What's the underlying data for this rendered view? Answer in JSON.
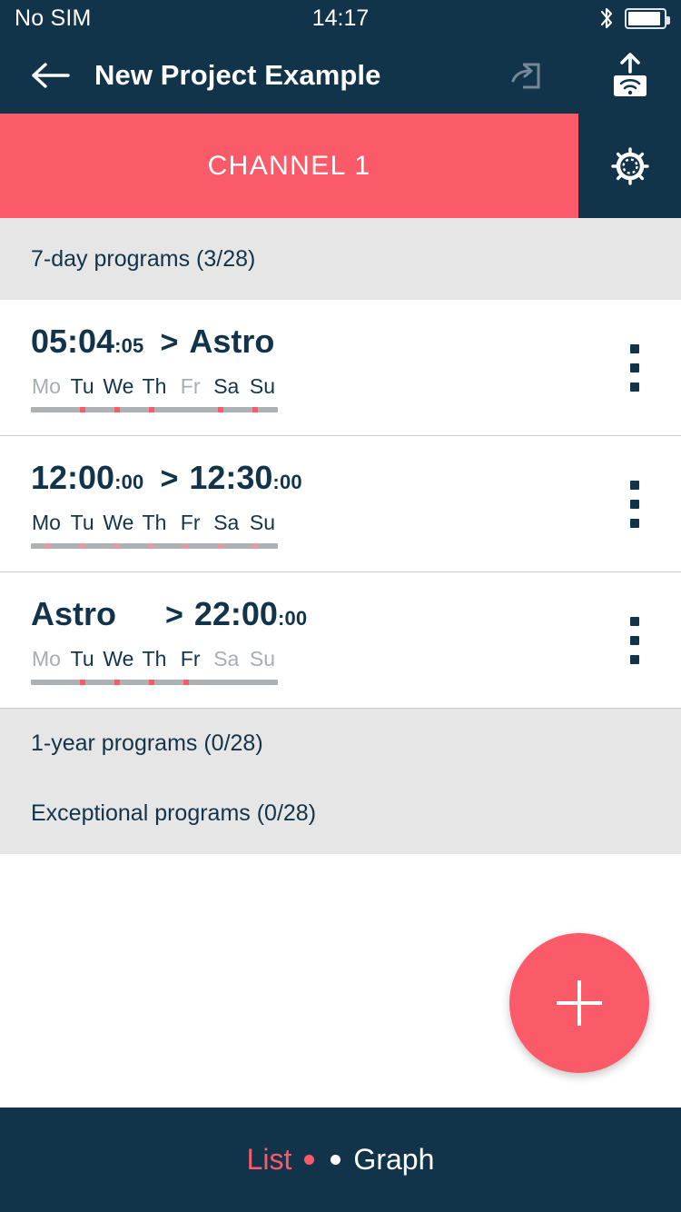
{
  "status_bar": {
    "carrier": "No SIM",
    "time": "14:17",
    "bluetooth_icon": "bluetooth-icon",
    "battery_icon": "battery-icon",
    "battery_level_percent": 92
  },
  "app_bar": {
    "back_icon": "back-arrow-icon",
    "title": "New Project Example",
    "connect_icon": "login-box-icon",
    "upload_icon": "upload-wifi-icon"
  },
  "channel_bar": {
    "channel_label": "CHANNEL 1",
    "settings_icon": "gear-icon",
    "accent_color": "#fb5b69",
    "dark_color": "#12344b"
  },
  "sections": {
    "seven_day": "7-day programs (3/28)",
    "one_year": "1-year programs (0/28)",
    "exceptional": "Exceptional programs (0/28)"
  },
  "day_labels": [
    "Mo",
    "Tu",
    "We",
    "Th",
    "Fr",
    "Sa",
    "Su"
  ],
  "programs": [
    {
      "start_time": "05:04",
      "start_seconds": ":05",
      "arrow": ">",
      "end_time": "Astro",
      "end_seconds": "",
      "start_is_astro": false,
      "end_is_astro": true,
      "active_days": [
        false,
        true,
        true,
        true,
        false,
        true,
        true
      ],
      "menu_icon": "kebab-menu-icon"
    },
    {
      "start_time": "12:00",
      "start_seconds": ":00",
      "arrow": ">",
      "end_time": "12:30",
      "end_seconds": ":00",
      "start_is_astro": false,
      "end_is_astro": false,
      "active_days": [
        true,
        true,
        true,
        true,
        true,
        true,
        true
      ],
      "menu_icon": "kebab-menu-icon"
    },
    {
      "start_time": "Astro",
      "start_seconds": "",
      "arrow": ">",
      "end_time": "22:00",
      "end_seconds": ":00",
      "start_is_astro": true,
      "end_is_astro": false,
      "active_days": [
        false,
        true,
        true,
        true,
        true,
        false,
        false
      ],
      "menu_icon": "kebab-menu-icon"
    }
  ],
  "fab": {
    "icon": "plus-icon",
    "label": "Add program"
  },
  "bottom_nav": {
    "list_label": "List",
    "graph_label": "Graph",
    "active": "List"
  }
}
